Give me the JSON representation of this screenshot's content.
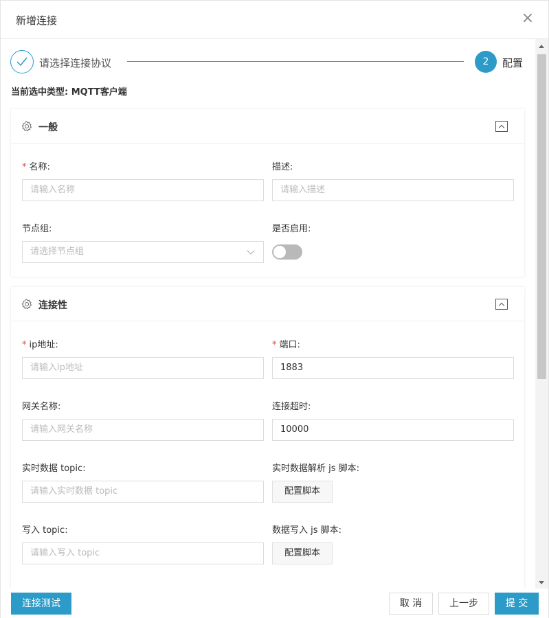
{
  "dialog": {
    "title": "新增连接",
    "close": "×"
  },
  "steps": [
    {
      "label": "请选择连接协议",
      "status": "done"
    },
    {
      "number": "2",
      "label": "配置",
      "status": "active"
    }
  ],
  "current_type": "当前选中类型:  MQTT客户端",
  "general": {
    "title": "一般",
    "name": {
      "label": "名称:",
      "placeholder": "请输入名称",
      "required": "*"
    },
    "description": {
      "label": "描述:",
      "placeholder": "请输入描述"
    },
    "node_group": {
      "label": "节点组:",
      "placeholder": "请选择节点组"
    },
    "enabled": {
      "label": "是否启用:",
      "value": false
    }
  },
  "connectivity": {
    "title": "连接性",
    "ip": {
      "label": "ip地址:",
      "placeholder": "请输入ip地址",
      "required": "*"
    },
    "port": {
      "label": "端口:",
      "value": "1883",
      "required": "*"
    },
    "gateway_name": {
      "label": "网关名称:",
      "placeholder": "请输入网关名称"
    },
    "timeout": {
      "label": "连接超时:",
      "value": "10000"
    },
    "realtime_topic": {
      "label": "实时数据 topic:",
      "placeholder": "请输入实时数据 topic"
    },
    "realtime_script": {
      "label": "实时数据解析 js 脚本:",
      "button": "配置脚本"
    },
    "write_topic": {
      "label": "写入 topic:",
      "placeholder": "请输入写入 topic"
    },
    "write_script": {
      "label": "数据写入 js 脚本:",
      "button": "配置脚本"
    }
  },
  "footer": {
    "test": "连接测试",
    "cancel": "取 消",
    "prev": "上一步",
    "submit": "提 交"
  },
  "colors": {
    "accent": "#2d9bc8",
    "required": "#e24a4a"
  }
}
